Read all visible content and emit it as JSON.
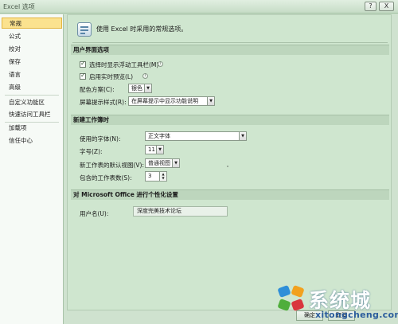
{
  "window": {
    "title": "Excel 选项",
    "help_label": "?",
    "close_label": "X"
  },
  "sidebar": {
    "items": [
      {
        "label": "常规",
        "active": true
      },
      {
        "label": "公式"
      },
      {
        "label": "校对"
      },
      {
        "label": "保存"
      },
      {
        "label": "语言"
      },
      {
        "label": "高级"
      },
      {
        "label": "自定义功能区"
      },
      {
        "label": "快速访问工具栏"
      },
      {
        "label": "加载项"
      },
      {
        "label": "信任中心"
      }
    ]
  },
  "header": {
    "text": "使用 Excel 时采用的常规选项。"
  },
  "ui_options": {
    "section_title": "用户界面选项",
    "show_mini_toolbar": {
      "label": "选择时显示浮动工具栏(M)",
      "checked": true
    },
    "enable_live_preview": {
      "label": "启用实时预览(L)",
      "checked": true
    },
    "color_scheme": {
      "label": "配色方案(C):",
      "value": "银色"
    },
    "screentip_style": {
      "label": "屏幕提示样式(R):",
      "value": "在屏幕提示中显示功能说明"
    },
    "info_symbol": "i"
  },
  "new_workbook": {
    "section_title": "新建工作簿时",
    "font": {
      "label": "使用的字体(N):",
      "value": "正文字体"
    },
    "font_size": {
      "label": "字号(Z):",
      "value": "11"
    },
    "default_view": {
      "label": "新工作表的默认视图(V):",
      "value": "普通视图"
    },
    "sheet_count": {
      "label": "包含的工作表数(S):",
      "value": "3"
    }
  },
  "personalize": {
    "section_title": "对 Microsoft Office 进行个性化设置",
    "username": {
      "label": "用户名(U):",
      "value": "深度完美技术论坛"
    }
  },
  "footer": {
    "ok_label": "确定",
    "cancel_label": "取消"
  },
  "watermark": {
    "brand": "系统城",
    "url": "xitongcheng.com",
    "colors": [
      "#2f8fd8",
      "#f2a11e",
      "#4fae3b",
      "#d9363e"
    ]
  }
}
